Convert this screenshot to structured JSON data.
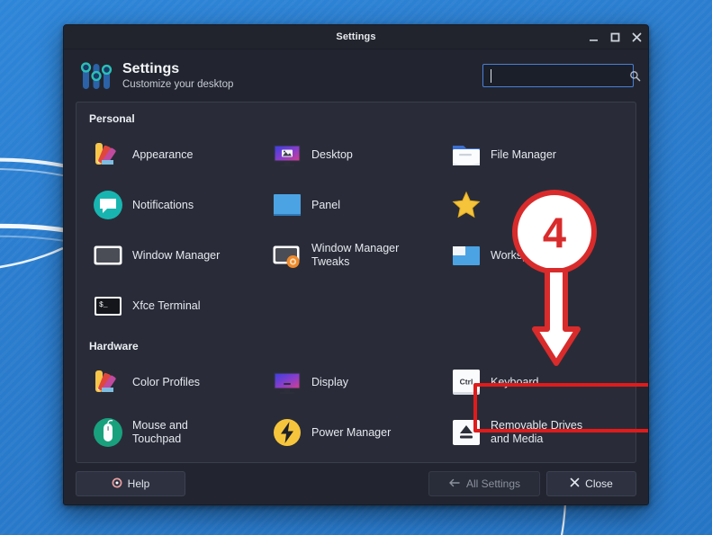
{
  "desktop": {
    "wallpaper_color": "#2a7fd4",
    "accent_stripe_color": "#ffffff"
  },
  "window": {
    "titlebar": {
      "title": "Settings",
      "controls": [
        {
          "name": "minimize",
          "glyph": "_"
        },
        {
          "name": "maximize",
          "glyph": "□"
        },
        {
          "name": "close",
          "glyph": "✕"
        }
      ]
    },
    "header": {
      "logo_icon": "sliders-icon",
      "title": "Settings",
      "subtitle": "Customize your desktop",
      "search": {
        "value": "",
        "placeholder": "",
        "icon": "search-icon"
      }
    },
    "sections": [
      {
        "id": "personal",
        "title": "Personal",
        "items": [
          {
            "id": "appearance",
            "label": "Appearance",
            "icon": "color-swatches-icon"
          },
          {
            "id": "desktop",
            "label": "Desktop",
            "icon": "monitor-wallpaper-icon"
          },
          {
            "id": "file-manager",
            "label": "File Manager",
            "icon": "folder-icon"
          },
          {
            "id": "notifications",
            "label": "Notifications",
            "icon": "speech-bubble-icon"
          },
          {
            "id": "panel",
            "label": "Panel",
            "icon": "blue-panel-icon"
          },
          {
            "id": "favorites",
            "label": "",
            "icon": "star-icon"
          },
          {
            "id": "window-manager",
            "label": "Window Manager",
            "icon": "window-icon"
          },
          {
            "id": "window-manager-tweaks",
            "label": "Window Manager\nTweaks",
            "icon": "window-gear-icon"
          },
          {
            "id": "workspaces",
            "label": "Workspaces",
            "icon": "workspaces-icon"
          },
          {
            "id": "xfce-terminal",
            "label": "Xfce Terminal",
            "icon": "terminal-icon"
          }
        ]
      },
      {
        "id": "hardware",
        "title": "Hardware",
        "items": [
          {
            "id": "color-profiles",
            "label": "Color Profiles",
            "icon": "color-swatches-icon"
          },
          {
            "id": "display",
            "label": "Display",
            "icon": "monitor-icon"
          },
          {
            "id": "keyboard",
            "label": "Keyboard",
            "icon": "ctrl-key-icon",
            "highlighted": true
          },
          {
            "id": "mouse-touchpad",
            "label": "Mouse and\nTouchpad",
            "icon": "mouse-icon"
          },
          {
            "id": "power-manager",
            "label": "Power Manager",
            "icon": "lightning-bolt-icon"
          },
          {
            "id": "removable-drives",
            "label": "Removable Drives\nand Media",
            "icon": "eject-icon"
          }
        ]
      }
    ],
    "footer": {
      "help_label": "Help",
      "help_icon": "help-circle-icon",
      "all_settings_label": "All Settings",
      "all_settings_icon": "arrow-left-icon",
      "all_settings_disabled": true,
      "close_label": "Close",
      "close_icon": "x-icon"
    }
  },
  "annotations": {
    "step_number": "4",
    "circle_color": "#d92b2b",
    "arrow_color": "#d92b2b",
    "highlight_box_color": "#e01b1b",
    "highlight_target": "Keyboard"
  }
}
